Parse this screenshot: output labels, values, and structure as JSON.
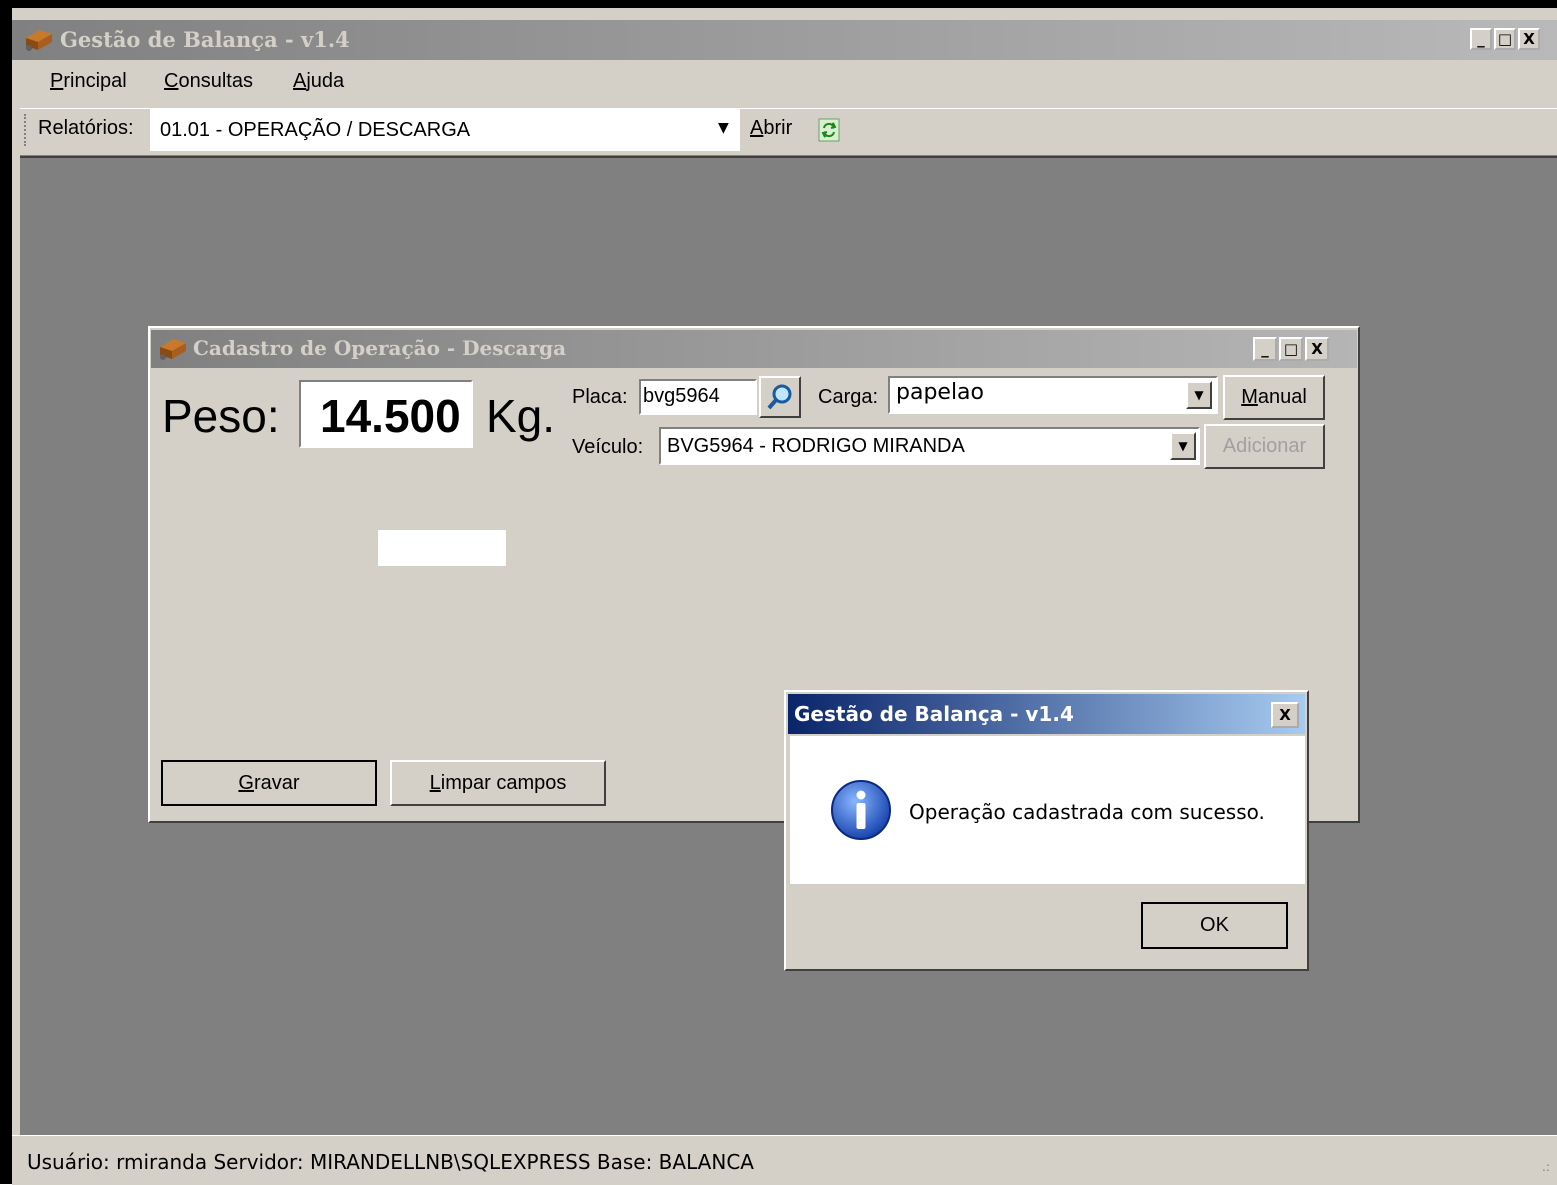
{
  "app": {
    "title": "Gestão de Balança - v1.4",
    "window_buttons": {
      "minimize": "_",
      "maximize": "□",
      "close": "X"
    }
  },
  "menu": {
    "principal": {
      "first": "P",
      "rest": "rincipal"
    },
    "consultas": {
      "first": "C",
      "rest": "onsultas"
    },
    "ajuda": {
      "first": "A",
      "rest": "juda"
    }
  },
  "toolbar": {
    "label": "Relatórios:",
    "report_selected": "01.01 - OPERAÇÃO / DESCARGA",
    "open": {
      "first": "A",
      "rest": "brir"
    },
    "refresh_icon": "refresh-icon"
  },
  "child_window": {
    "title": "Cadastro de Operação - Descarga",
    "peso_label": "Peso:",
    "peso_value": "14.500",
    "peso_unit": "Kg.",
    "placa_label": "Placa:",
    "placa_value": "bvg5964",
    "carga_label": "Carga:",
    "carga_value": "papelao",
    "manual_button": {
      "first": "M",
      "rest": "anual"
    },
    "veiculo_label": "Veículo:",
    "veiculo_value": "BVG5964 - RODRIGO MIRANDA",
    "adicionar_button": "Adicionar",
    "gravar_button": {
      "first": "G",
      "rest": "ravar"
    },
    "limpar_button": {
      "first": "L",
      "rest": "impar campos"
    }
  },
  "message_box": {
    "title": "Gestão de Balança - v1.4",
    "close": "X",
    "icon": "info-icon",
    "message": "Operação cadastrada com sucesso.",
    "ok_button": "OK"
  },
  "status_bar": {
    "text": "Usuário: rmiranda  Servidor: MIRANDELLNB\\SQLEXPRESS  Base: BALANCA"
  },
  "colors": {
    "face": "#d4d0c8",
    "mdi_background": "#808080",
    "inactive_title_start": "#808080",
    "active_title_start": "#0a246a",
    "active_title_end": "#a6caf0"
  }
}
